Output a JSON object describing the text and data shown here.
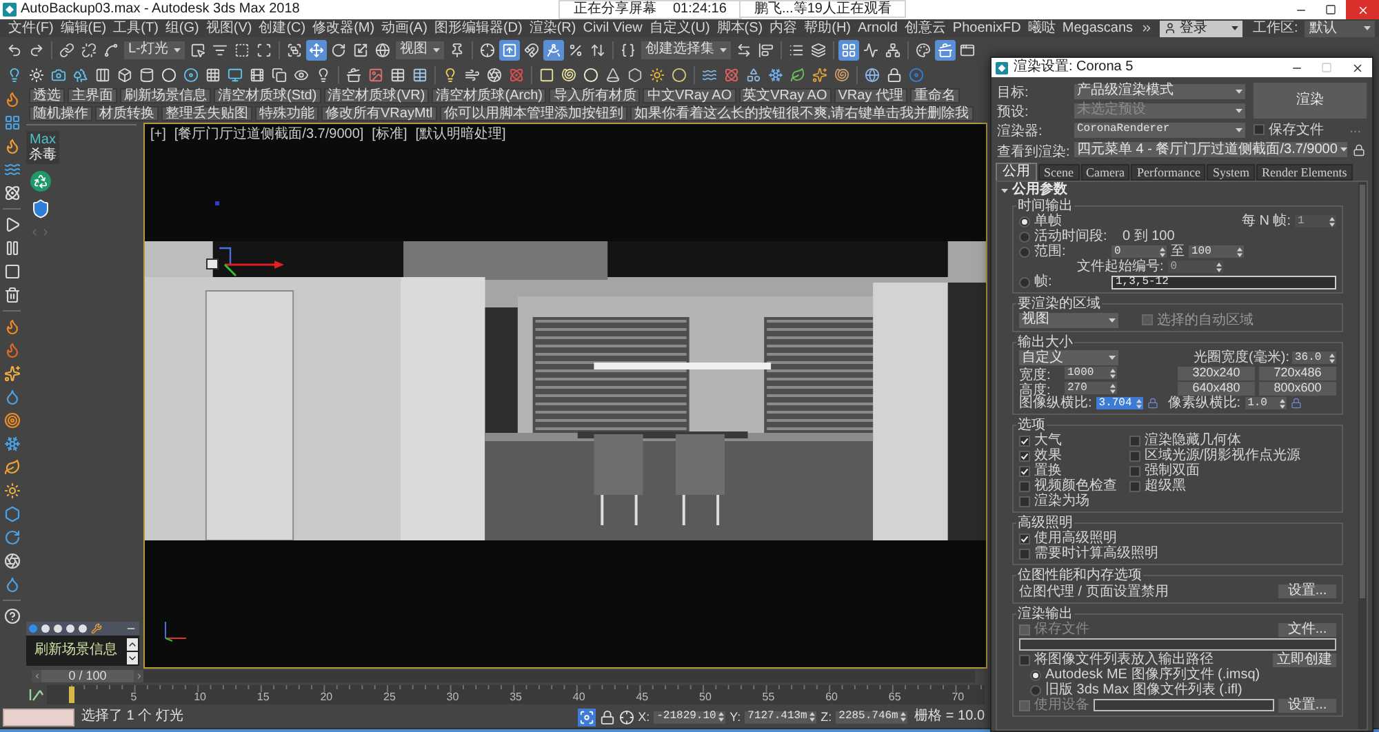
{
  "window": {
    "title": "AutoBackup03.max - Autodesk 3ds Max 2018"
  },
  "share_banner": {
    "status": "正在分享屏幕",
    "time": "01:24:16",
    "viewers": "鹏飞...等19人正在观看"
  },
  "menu": [
    "文件(F)",
    "编辑(E)",
    "工具(T)",
    "组(G)",
    "视图(V)",
    "创建(C)",
    "修改器(M)",
    "动画(A)",
    "图形编辑器(D)",
    "渲染(R)",
    "Civil View",
    "自定义(U)",
    "脚本(S)",
    "内容",
    "帮助(H)",
    "Arnold",
    "创意云",
    "PhoenixFD",
    "曦哒",
    "Megascans"
  ],
  "account": {
    "user": "登录",
    "workspace_label": "工作区:",
    "workspace": "默认"
  },
  "main_toolbar": [
    {
      "kind": "icon",
      "selected": false
    },
    {
      "kind": "icon",
      "selected": false
    },
    {
      "kind": "separator"
    },
    {
      "kind": "icon",
      "selected": false
    },
    {
      "kind": "icon",
      "selected": false
    },
    {
      "kind": "icon",
      "selected": false
    },
    {
      "kind": "dropdown",
      "value": "L-灯光"
    },
    {
      "kind": "icon",
      "selected": false
    },
    {
      "kind": "icon",
      "selected": false
    },
    {
      "kind": "icon",
      "selected": false
    },
    {
      "kind": "icon",
      "selected": false
    },
    {
      "kind": "separator"
    },
    {
      "kind": "icon",
      "selected": false
    },
    {
      "kind": "icon",
      "selected": true
    },
    {
      "kind": "icon",
      "selected": false
    },
    {
      "kind": "icon",
      "selected": false
    },
    {
      "kind": "icon",
      "selected": false
    },
    {
      "kind": "dropdown",
      "value": "视图"
    },
    {
      "kind": "icon",
      "selected": false
    },
    {
      "kind": "separator"
    },
    {
      "kind": "icon",
      "selected": false
    },
    {
      "kind": "icon",
      "selected": true
    },
    {
      "kind": "icon",
      "selected": false
    },
    {
      "kind": "icon",
      "selected": true
    },
    {
      "kind": "icon",
      "selected": false
    },
    {
      "kind": "icon",
      "selected": false
    },
    {
      "kind": "separator"
    },
    {
      "kind": "icon",
      "selected": false
    },
    {
      "kind": "dropdown",
      "value": "创建选择集"
    },
    {
      "kind": "icon",
      "selected": false
    },
    {
      "kind": "icon",
      "selected": false
    },
    {
      "kind": "separator"
    },
    {
      "kind": "icon",
      "selected": false
    },
    {
      "kind": "icon",
      "selected": false
    },
    {
      "kind": "separator"
    },
    {
      "kind": "icon",
      "selected": true
    },
    {
      "kind": "icon",
      "selected": false
    },
    {
      "kind": "icon",
      "selected": false
    },
    {
      "kind": "separator"
    },
    {
      "kind": "icon",
      "selected": false
    },
    {
      "kind": "icon",
      "selected": true
    },
    {
      "kind": "icon",
      "selected": false
    }
  ],
  "script_buttons": [
    "透选",
    "主界面",
    "刷新场景信息",
    "清空材质球(Std)",
    "清空材质球(VR)",
    "清空材质球(Arch)",
    "导入所有材质",
    "中文VRay AO",
    "英文VRay AO",
    "VRay 代理",
    "重命名",
    "随机操作",
    "材质转换",
    "整理丢失贴图",
    "特殊功能",
    "修改所有VRayMtl",
    "你可以用脚本管理添加按钮到",
    "如果你看着这么长的按钮很不爽,请右键单击我并删除我"
  ],
  "antivirus": {
    "line1": "Max",
    "line2": "杀毒"
  },
  "scene_info": {
    "button": "刷新场景信息"
  },
  "viewport": {
    "labels": [
      "[+]",
      "[餐厅门厅过道侧截面/3.7/9000]",
      "[标准]",
      "[默认明暗处理]"
    ]
  },
  "timeline": {
    "frame": "0 / 100",
    "level": 0,
    "ruler_labels": [
      "5",
      "10",
      "15",
      "20",
      "25",
      "30",
      "35",
      "40",
      "45",
      "50",
      "55",
      "60",
      "65",
      "70"
    ]
  },
  "status_bar": {
    "selection": "选择了 1 个 灯光",
    "isolate_selected": true,
    "coordinates": [
      {
        "label": "X:",
        "value": "-21829.10"
      },
      {
        "label": "Y:",
        "value": "7127.413m"
      },
      {
        "label": "Z:",
        "value": "2285.746m"
      }
    ],
    "grid": "栅格 = 10.0"
  },
  "render_dialog": {
    "title": "渲染设置: Corona 5",
    "target": {
      "label": "目标:",
      "value": "产品级渲染模式"
    },
    "preset": {
      "label": "预设:",
      "value": "未选定预设",
      "disabled": true
    },
    "renderer": {
      "label": "渲染器:",
      "value": "CoronaRenderer"
    },
    "save_file": {
      "label": "保存文件",
      "checked": false
    },
    "more_button": "...",
    "view": {
      "label": "查看到渲染:",
      "value": "四元菜单 4 - 餐厅门厅过道侧截面/3.7/9000"
    },
    "render_button": "渲染",
    "tabs": [
      {
        "label": "公用",
        "selected": true
      },
      {
        "label": "Scene",
        "selected": false
      },
      {
        "label": "Camera",
        "selected": false
      },
      {
        "label": "Performance",
        "selected": false
      },
      {
        "label": "System",
        "selected": false
      },
      {
        "label": "Render Elements",
        "selected": false
      }
    ],
    "rollout": {
      "title": "公用参数",
      "expanded": true
    },
    "time_output": {
      "title": "时间输出",
      "modes": [
        {
          "label": "单帧",
          "selected": true
        },
        {
          "label": "活动时间段:",
          "selected": false
        },
        {
          "label": "范围:",
          "selected": false
        },
        {
          "label": "帧:",
          "selected": false
        }
      ],
      "every_n": {
        "label": "每 N 帧:",
        "value": "1",
        "disabled": true
      },
      "active_range": "0 到 100",
      "range": {
        "start": "0",
        "to": "至",
        "end": "100"
      },
      "file_start": {
        "label": "文件起始编号:",
        "value": "0",
        "disabled": true
      },
      "frames": "1,3,5-12"
    },
    "area": {
      "title": "要渲染的区域",
      "view": "视图",
      "auto_region": {
        "label": "选择的自动区域",
        "checked": false,
        "disabled": true
      }
    },
    "output_size": {
      "title": "输出大小",
      "preset": "自定义",
      "aperture": {
        "label": "光圈宽度(毫米):",
        "value": "36.0"
      },
      "width": {
        "label": "宽度:",
        "value": "1000"
      },
      "height": {
        "label": "高度:",
        "value": "270"
      },
      "presets": [
        "320x240",
        "720x486",
        "640x480",
        "800x600"
      ],
      "image_aspect": {
        "label": "图像纵横比:",
        "value": "3.704",
        "selected": true
      },
      "pixel_aspect": {
        "label": "像素纵横比:",
        "value": "1.0"
      }
    },
    "options": {
      "title": "选项",
      "items": [
        {
          "label": "大气",
          "checked": true
        },
        {
          "label": "渲染隐藏几何体",
          "checked": false
        },
        {
          "label": "效果",
          "checked": true
        },
        {
          "label": "区域光源/阴影视作点光源",
          "checked": false
        },
        {
          "label": "置换",
          "checked": true
        },
        {
          "label": "强制双面",
          "checked": false
        },
        {
          "label": "视频颜色检查",
          "checked": false
        },
        {
          "label": "超级黑",
          "checked": false
        },
        {
          "label": "渲染为场",
          "checked": false
        }
      ]
    },
    "advanced_lighting": {
      "title": "高级照明",
      "items": [
        {
          "label": "使用高级照明",
          "checked": true
        },
        {
          "label": "需要时计算高级照明",
          "checked": false
        }
      ]
    },
    "bitmap": {
      "title": "位图性能和内存选项",
      "text": "位图代理 / 页面设置禁用",
      "button": "设置..."
    },
    "render_output": {
      "title": "渲染输出",
      "save_file": {
        "label": "保存文件",
        "checked": false,
        "disabled": true
      },
      "files_button": "文件...",
      "put_list": {
        "label": "将图像文件列表放入输出路径",
        "checked": false
      },
      "create_button": "立即创建",
      "formats": [
        {
          "label": "Autodesk ME 图像序列文件 (.imsq)",
          "selected": true
        },
        {
          "label": "旧版 3ds Max 图像文件列表 (.ifl)",
          "selected": false
        }
      ],
      "use_device": {
        "label": "使用设备",
        "checked": false,
        "disabled": true
      },
      "device_button": "设置..."
    }
  }
}
